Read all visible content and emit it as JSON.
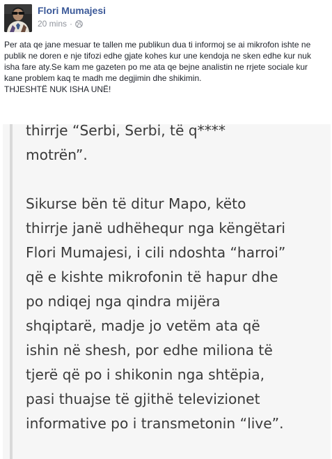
{
  "post": {
    "author": "Flori Mumajesi",
    "time": "20 mins",
    "separator": "·",
    "privacy_icon": "globe-icon",
    "text_main": "Per ata qe jane mesuar te tallen me publikun dua ti informoj se ai mikrofon ishte ne publik ne doren e nje tifozi edhe gjate kohes kur une kendoja ne sken edhe kur nuk isha fare aty.Se kam me gazeten po me ata qe bejne analistin ne rrjete sociale kur kane problem kaq te madh me degjimin dhe shikimin.",
    "text_emphasis": "THJESHTË NUK ISHA UNË!"
  },
  "article": {
    "lines_para1": [
      "thirrje “Serbi, Serbi, të q****",
      "motrën”."
    ],
    "lines_para2": [
      "Sikurse bën të ditur Mapo, këto",
      "thirrje janë udhëhequr nga këngëtari",
      "Flori Mumajesi, i cili ndoshta “harroi”",
      "që e kishte mikrofonin të hapur dhe",
      "po ndiqej nga qindra mijëra",
      "shqiptarë, madje jo vetëm ata që",
      "ishin në shesh, por edhe miliona të",
      "tjerë që po i shikonin nga shtëpia,",
      "pasi thuajse të gjithë televizionet",
      "informative po i transmetonin “live”."
    ]
  },
  "colors": {
    "author_link": "#3b5998",
    "meta_gray": "#90949c",
    "body_text": "#1d2129",
    "article_bg": "#f6f6f6",
    "article_text": "#3a3a3a",
    "quote_bar": "#d9d9d9"
  }
}
